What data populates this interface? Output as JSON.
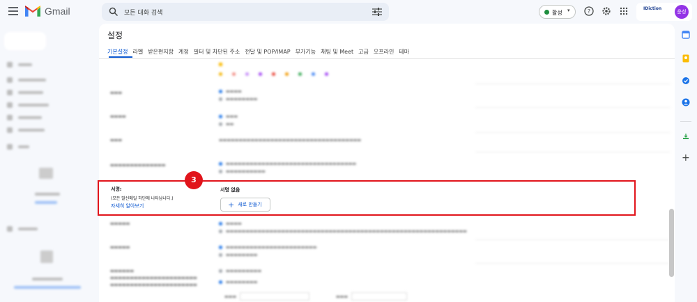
{
  "header": {
    "app_name": "Gmail",
    "search_placeholder": "모든 대화 검색",
    "status_label": "활성",
    "brand_logo_text": "IDiction",
    "avatar_text": "윤성"
  },
  "settings": {
    "title": "설정",
    "tabs": [
      {
        "label": "기본설정",
        "active": true
      },
      {
        "label": "라벨",
        "active": false
      },
      {
        "label": "받은편지함",
        "active": false
      },
      {
        "label": "계정",
        "active": false
      },
      {
        "label": "필터 및 차단된 주소",
        "active": false
      },
      {
        "label": "전달 및 POP/IMAP",
        "active": false
      },
      {
        "label": "부가기능",
        "active": false
      },
      {
        "label": "채팅 및 Meet",
        "active": false
      },
      {
        "label": "고급",
        "active": false
      },
      {
        "label": "오프라인",
        "active": false
      },
      {
        "label": "테마",
        "active": false
      }
    ]
  },
  "signature": {
    "label": "서명:",
    "description": "(모든 발신메일 하단에 나타납니다.)",
    "learn_more": "자세히 알아보기",
    "none_text": "서명 없음",
    "new_button": "새로 만들기"
  },
  "annotation": {
    "step_number": "3",
    "highlight_color": "#e1141b"
  },
  "colors": {
    "accent": "#0b57d0",
    "highlight": "#e1141b",
    "status_active": "#1e8e3e",
    "avatar": "#9334e6"
  }
}
